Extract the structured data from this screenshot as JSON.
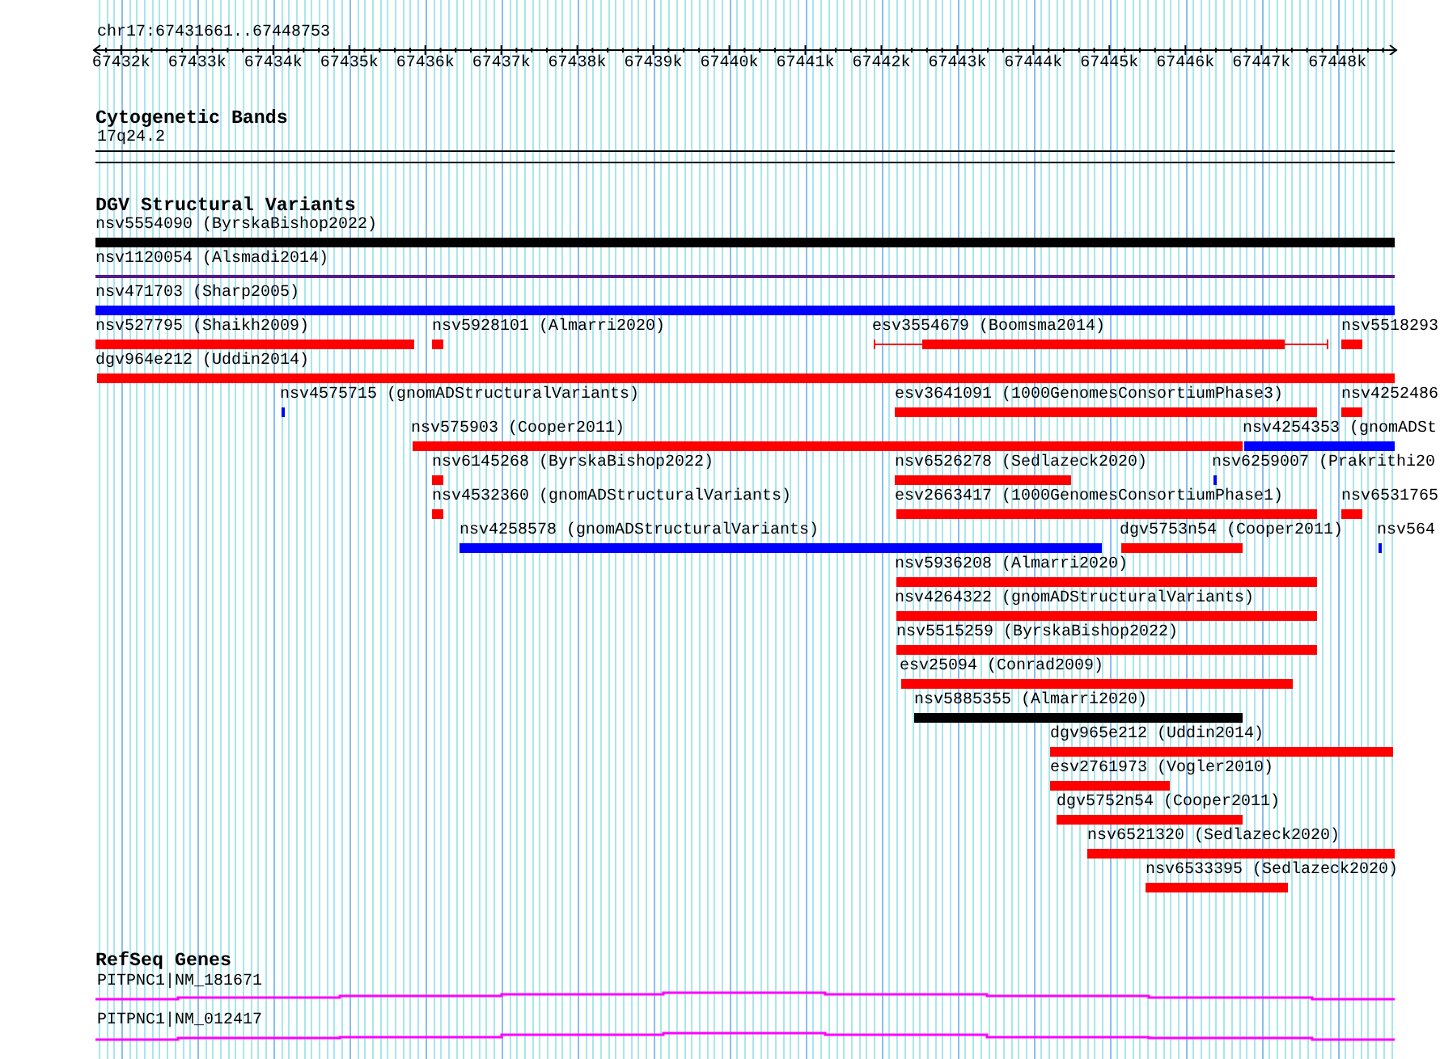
{
  "ruler": {
    "label": "chr17:67431661..67448753",
    "ticks": [
      "67432k",
      "67433k",
      "67434k",
      "67435k",
      "67436k",
      "67437k",
      "67438k",
      "67439k",
      "67440k",
      "67441k",
      "67442k",
      "67443k",
      "67444k",
      "67445k",
      "67446k",
      "67447k",
      "67448k"
    ]
  },
  "cytogenetic_bands": {
    "title": "Cytogenetic Bands",
    "band": "17q24.2"
  },
  "dgv_structural_variants": {
    "title": "DGV Structural Variants",
    "rows": [
      {
        "features": [
          {
            "label": "nsv5554090 (ByrskaBishop2022)",
            "kind": "bar",
            "color": "#000000"
          }
        ]
      },
      {
        "features": [
          {
            "label": "nsv1120054 (Alsmadi2014)",
            "kind": "line",
            "color": "#551a8b"
          }
        ]
      },
      {
        "features": [
          {
            "label": "nsv471703 (Sharp2005)",
            "kind": "bar",
            "color": "#0000ff"
          }
        ]
      },
      {
        "features": [
          {
            "label": "nsv527795 (Shaikh2009)",
            "kind": "bar",
            "color": "#ff0000"
          },
          {
            "label": "nsv5928101 (Almarri2020)",
            "kind": "bar",
            "color": "#ff0000"
          },
          {
            "label": "esv3554679 (Boomsma2014)",
            "kind": "bracketed",
            "color": "#ff0000"
          },
          {
            "label": "nsv5518293",
            "kind": "bar",
            "color": "#ff0000"
          }
        ]
      },
      {
        "features": [
          {
            "label": "dgv964e212 (Uddin2014)",
            "kind": "bar",
            "color": "#ff0000"
          }
        ]
      },
      {
        "features": [
          {
            "label": "nsv4575715 (gnomADStructuralVariants)",
            "kind": "bar",
            "color": "#0000ff"
          },
          {
            "label": "esv3641091 (1000GenomesConsortiumPhase3)",
            "kind": "bar",
            "color": "#ff0000"
          },
          {
            "label": "nsv4252486",
            "kind": "bar",
            "color": "#ff0000"
          }
        ]
      },
      {
        "features": [
          {
            "label": "nsv575903 (Cooper2011)",
            "kind": "bar",
            "color": "#ff0000"
          },
          {
            "label": "nsv4254353 (gnomADSt",
            "kind": "bar",
            "color": "#0000ff"
          }
        ]
      },
      {
        "features": [
          {
            "label": "nsv6145268 (ByrskaBishop2022)",
            "kind": "bar",
            "color": "#ff0000"
          },
          {
            "label": "nsv6526278 (Sedlazeck2020)",
            "kind": "bar",
            "color": "#ff0000"
          },
          {
            "label": "nsv6259007 (Prakrithi20",
            "kind": "bar",
            "color": "#0000ff"
          }
        ]
      },
      {
        "features": [
          {
            "label": "nsv4532360 (gnomADStructuralVariants)",
            "kind": "bar",
            "color": "#ff0000"
          },
          {
            "label": "esv2663417 (1000GenomesConsortiumPhase1)",
            "kind": "bar",
            "color": "#ff0000"
          },
          {
            "label": "nsv6531765",
            "kind": "bar",
            "color": "#ff0000"
          }
        ]
      },
      {
        "features": [
          {
            "label": "nsv4258578 (gnomADStructuralVariants)",
            "kind": "bar",
            "color": "#0000ff"
          },
          {
            "label": "dgv5753n54 (Cooper2011)",
            "kind": "bar",
            "color": "#ff0000"
          },
          {
            "label": "nsv564",
            "kind": "bar",
            "color": "#0000ff"
          }
        ]
      },
      {
        "features": [
          {
            "label": "nsv5936208 (Almarri2020)",
            "kind": "bar",
            "color": "#ff0000"
          }
        ]
      },
      {
        "features": [
          {
            "label": "nsv4264322 (gnomADStructuralVariants)",
            "kind": "bar",
            "color": "#ff0000"
          }
        ]
      },
      {
        "features": [
          {
            "label": "nsv5515259 (ByrskaBishop2022)",
            "kind": "bar",
            "color": "#ff0000"
          }
        ]
      },
      {
        "features": [
          {
            "label": "esv25094 (Conrad2009)",
            "kind": "bar",
            "color": "#ff0000"
          }
        ]
      },
      {
        "features": [
          {
            "label": "nsv5885355 (Almarri2020)",
            "kind": "bar",
            "color": "#000000"
          }
        ]
      },
      {
        "features": [
          {
            "label": "dgv965e212 (Uddin2014)",
            "kind": "bar",
            "color": "#ff0000"
          }
        ]
      },
      {
        "features": [
          {
            "label": "esv2761973 (Vogler2010)",
            "kind": "bar",
            "color": "#ff0000"
          }
        ]
      },
      {
        "features": [
          {
            "label": "dgv5752n54 (Cooper2011)",
            "kind": "bar",
            "color": "#ff0000"
          }
        ]
      },
      {
        "features": [
          {
            "label": "nsv6521320 (Sedlazeck2020)",
            "kind": "bar",
            "color": "#ff0000"
          }
        ]
      },
      {
        "features": [
          {
            "label": "nsv6533395 (Sedlazeck2020)",
            "kind": "bar",
            "color": "#ff0000"
          }
        ]
      }
    ]
  },
  "refseq_genes": {
    "title": "RefSeq Genes",
    "transcripts": [
      {
        "label": "PITPNC1|NM_181671"
      },
      {
        "label": "PITPNC1|NM_012417"
      }
    ]
  }
}
